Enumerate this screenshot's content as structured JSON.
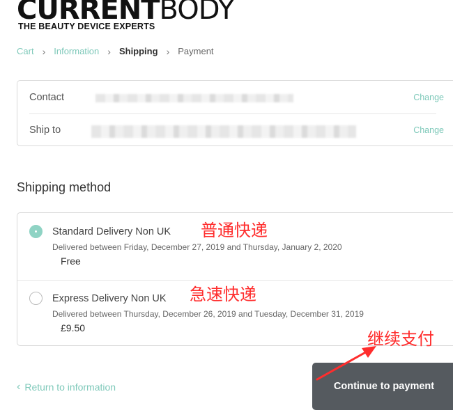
{
  "brand": {
    "logo_bold": "CURRENT",
    "logo_light": "BODY",
    "tagline": "THE BEAUTY DEVICE EXPERTS"
  },
  "breadcrumb": {
    "items": [
      "Cart",
      "Information",
      "Shipping",
      "Payment"
    ],
    "current": "Shipping"
  },
  "review": {
    "contact_label": "Contact",
    "ship_to_label": "Ship to",
    "change_label": "Change"
  },
  "shipping": {
    "title": "Shipping method",
    "options": [
      {
        "name": "Standard Delivery Non UK",
        "description": "Delivered between Friday, December 27, 2019 and Thursday, January 2, 2020",
        "price": "Free",
        "selected": true,
        "annotation": "普通快递"
      },
      {
        "name": "Express Delivery Non UK",
        "description": "Delivered between Thursday, December 26, 2019 and Tuesday, December 31, 2019",
        "price": "£9.50",
        "selected": false,
        "annotation": "急速快递"
      }
    ]
  },
  "footer": {
    "return_label": "Return to information",
    "continue_label": "Continue to payment",
    "continue_annotation": "继续支付"
  },
  "colors": {
    "accent": "#7fc9ba",
    "button": "#555a5f",
    "annotation": "#ff2d2d"
  },
  "icons": {
    "breadcrumb_separator": "chevron-right-icon",
    "return": "chevron-left-icon",
    "annotation_arrow": "arrow-icon"
  }
}
